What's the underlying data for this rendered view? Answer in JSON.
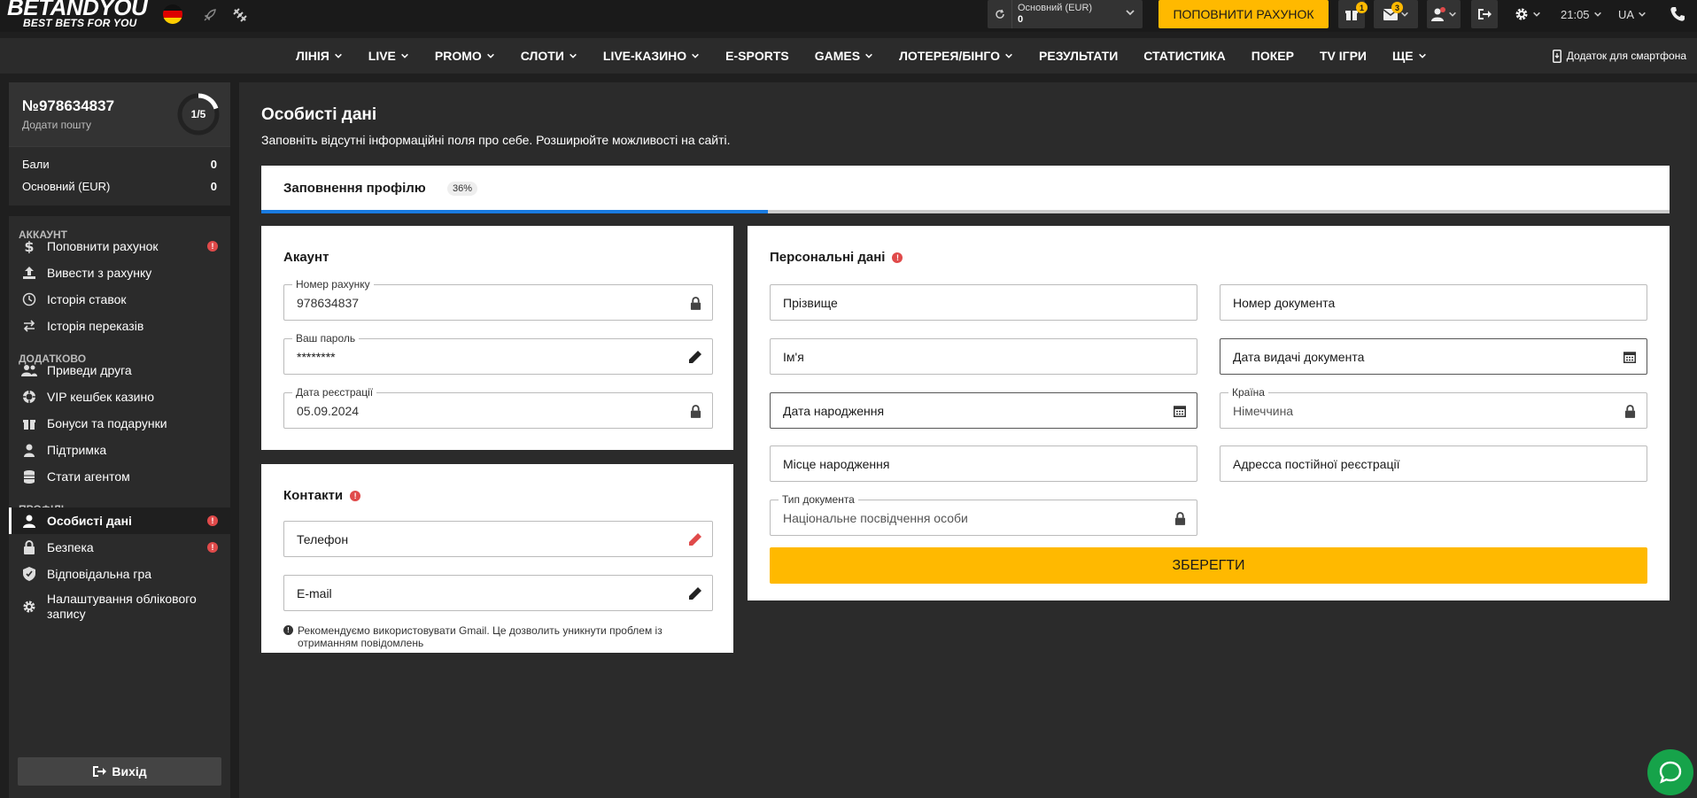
{
  "header": {
    "logo_main": "BETANDYOU",
    "logo_tagline": "BEST BETS FOR YOU",
    "balance_label": "Основний (EUR)",
    "balance_value": "0",
    "deposit_label": "ПОПОВНИТИ РАХУНОК",
    "gifts_badge": "1",
    "messages_badge": "3",
    "time": "21:05",
    "language": "UA"
  },
  "nav": {
    "items": [
      {
        "label": "Лінія",
        "dropdown": true
      },
      {
        "label": "Live",
        "dropdown": true
      },
      {
        "label": "Promo",
        "dropdown": true
      },
      {
        "label": "Слоти",
        "dropdown": true
      },
      {
        "label": "Live-казино",
        "dropdown": true
      },
      {
        "label": "E-Sports",
        "dropdown": false
      },
      {
        "label": "Games",
        "dropdown": true
      },
      {
        "label": "Лотерея/Бінго",
        "dropdown": true
      },
      {
        "label": "Результати",
        "dropdown": false
      },
      {
        "label": "Статистика",
        "dropdown": false
      },
      {
        "label": "Покер",
        "dropdown": false
      },
      {
        "label": "TV Ігри",
        "dropdown": false
      },
      {
        "label": "Ще",
        "dropdown": true
      }
    ],
    "app_link": "Додаток для смартфона"
  },
  "sidebar": {
    "account_number": "№978634837",
    "add_email": "Додати пошту",
    "progress_text": "1/5",
    "progress_value": 0.2,
    "balances": [
      {
        "label": "Бали",
        "value": "0"
      },
      {
        "label": "Основний (EUR)",
        "value": "0"
      }
    ],
    "sections": {
      "account": "Аккаунт",
      "extra": "Додатково",
      "profile": "Профіль"
    },
    "items": {
      "deposit": "Поповнити рахунок",
      "withdraw": "Вивести з рахунку",
      "bet_history": "Історія ставок",
      "transfer_history": "Історія переказів",
      "invite": "Приведи друга",
      "vip": "VIP кешбек казино",
      "bonuses": "Бонуси та подарунки",
      "support": "Підтримка",
      "agent": "Стати агентом",
      "personal": "Особисті дані",
      "security": "Безпека",
      "responsible": "Відповідальна гра",
      "account_settings": "Налаштування облікового запису"
    },
    "logout": "Вихід"
  },
  "main": {
    "title": "Особисті дані",
    "subtitle": "Заповніть відсутні інформаційні поля про себе. Розширюйте можливості на сайті.",
    "profile_progress_label": "Заповнення профілю",
    "profile_progress_pct": "36%",
    "profile_progress_value": 0.36,
    "account_card": {
      "title": "Акаунт",
      "account_number_label": "Номер рахунку",
      "account_number_value": "978634837",
      "password_label": "Ваш пароль",
      "password_value": "********",
      "reg_date_label": "Дата реєстрації",
      "reg_date_value": "05.09.2024"
    },
    "contacts_card": {
      "title": "Контакти",
      "phone_placeholder": "Телефон",
      "email_placeholder": "E-mail",
      "note": "Рекомендуємо використовувати Gmail. Це дозволить уникнути проблем із отриманням повідомлень"
    },
    "personal_card": {
      "title": "Персональні дані",
      "surname": "Прізвище",
      "doc_number": "Номер документа",
      "name": "Ім'я",
      "doc_issue_date": "Дата видачі документа",
      "birth_date": "Дата народження",
      "country_label": "Країна",
      "country_value": "Німеччина",
      "birth_place": "Місце народження",
      "address": "Адресса постійної реєстрації",
      "doc_type_label": "Тип документа",
      "doc_type_value": "Національне посвідчення особи",
      "save": "ЗБЕРЕГТИ"
    }
  },
  "colors": {
    "accent": "#ffb900",
    "progress": "#1a7be0",
    "alert": "#e04a4a",
    "chat": "#16a34a"
  }
}
